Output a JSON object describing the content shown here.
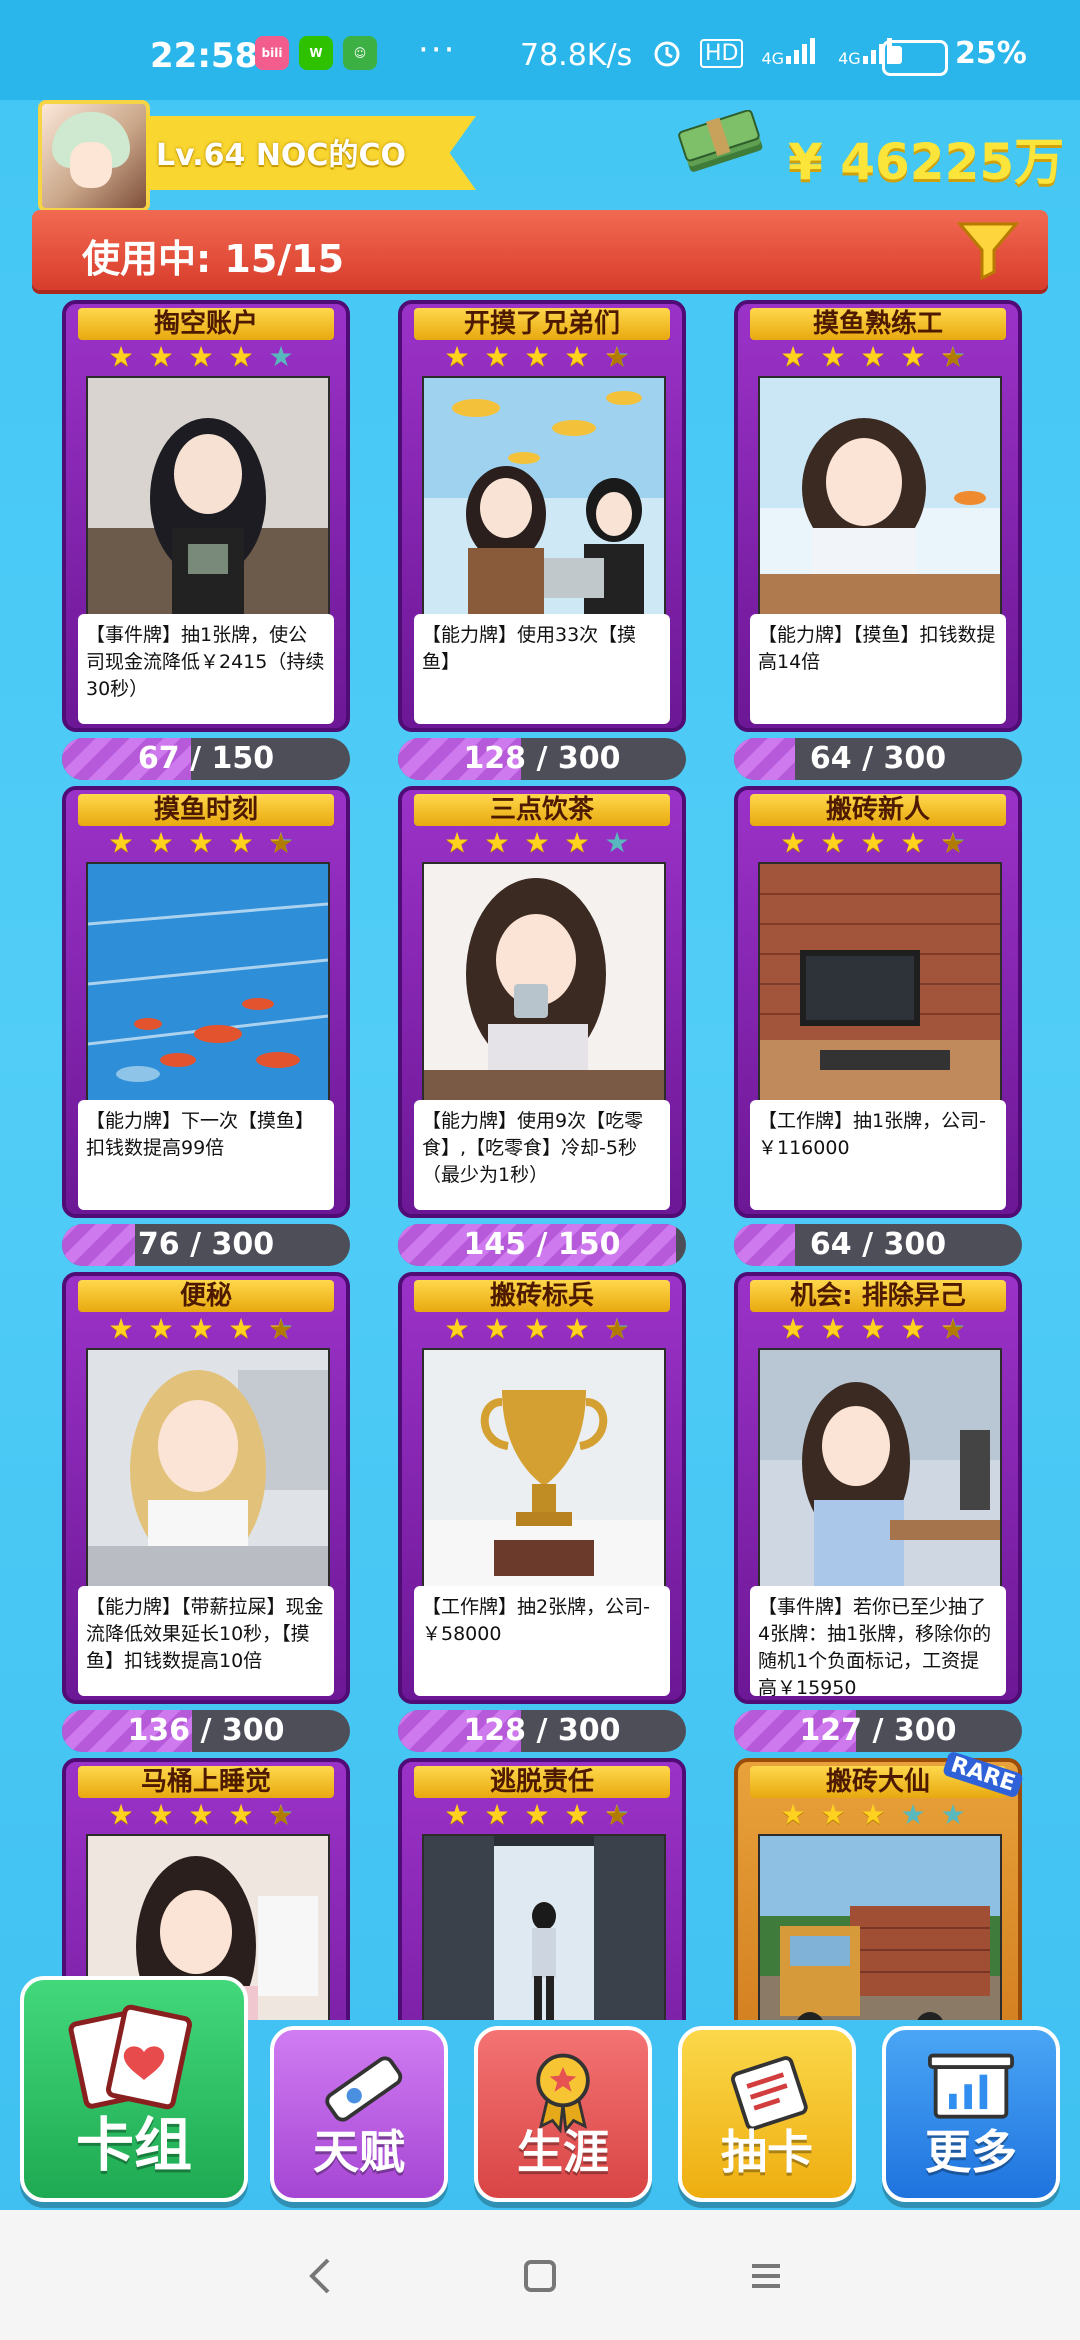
{
  "status": {
    "time": "22:58",
    "apps": [
      {
        "name": "bilibili-icon",
        "text": "bili",
        "color": "#f25d8e"
      },
      {
        "name": "wechat-icon",
        "text": "W",
        "color": "#2dc100"
      },
      {
        "name": "cat-app-icon",
        "text": "☺",
        "color": "#3cb043"
      }
    ],
    "dots": "···",
    "net_speed": "78.8K/s",
    "hd": "HD",
    "net1": "4G",
    "net2": "4G",
    "battery": "25%",
    "battery_level": 0.25
  },
  "player": {
    "level_name": "Lv.64 NOC的CO",
    "money": "¥ 46225万"
  },
  "usage": {
    "text": "使用中: 15/15"
  },
  "cards": [
    {
      "title": "掏空账户",
      "stars": [
        1,
        1,
        1,
        1,
        0
      ],
      "desc": "【事件牌】抽1张牌，使公司现金流降低￥2415（持续30秒）",
      "progress_text": "67",
      "progress_total": "/ 150",
      "progress": 0.447,
      "art": "a"
    },
    {
      "title": "开摸了兄弟们",
      "stars": [
        1,
        1,
        1,
        1,
        0.5
      ],
      "desc": "【能力牌】使用33次【摸鱼】",
      "progress_text": "128",
      "progress_total": "/ 300",
      "progress": 0.427,
      "art": "b"
    },
    {
      "title": "摸鱼熟练工",
      "stars": [
        1,
        1,
        1,
        1,
        0.5
      ],
      "desc": "【能力牌】【摸鱼】扣钱数提高14倍",
      "progress_text": "64",
      "progress_total": "/ 300",
      "progress": 0.213,
      "art": "c"
    },
    {
      "title": "摸鱼时刻",
      "stars": [
        1,
        1,
        1,
        1,
        0.5
      ],
      "desc": "【能力牌】下一次【摸鱼】扣钱数提高99倍",
      "progress_text": "76",
      "progress_total": "/ 300",
      "progress": 0.253,
      "art": "d"
    },
    {
      "title": "三点饮茶",
      "stars": [
        1,
        1,
        1,
        1,
        0
      ],
      "desc": "【能力牌】使用9次【吃零食】,【吃零食】冷却-5秒（最少为1秒）",
      "progress_text": "145",
      "progress_total": "/ 150",
      "progress": 0.967,
      "art": "e"
    },
    {
      "title": "搬砖新人",
      "stars": [
        1,
        1,
        1,
        1,
        0.5
      ],
      "desc": "【工作牌】抽1张牌，公司-￥116000",
      "progress_text": "64",
      "progress_total": "/ 300",
      "progress": 0.213,
      "art": "f"
    },
    {
      "title": "便秘",
      "stars": [
        1,
        1,
        1,
        1,
        0.5
      ],
      "desc": "【能力牌】【带薪拉屎】现金流降低效果延长10秒，【摸鱼】扣钱数提高10倍",
      "progress_text": "136",
      "progress_total": "/ 300",
      "progress": 0.453,
      "art": "g"
    },
    {
      "title": "搬砖标兵",
      "stars": [
        1,
        1,
        1,
        1,
        0.5
      ],
      "desc": "【工作牌】抽2张牌，公司-￥58000",
      "progress_text": "128",
      "progress_total": "/ 300",
      "progress": 0.427,
      "art": "h"
    },
    {
      "title": "机会: 排除异己",
      "stars": [
        1,
        1,
        1,
        1,
        0.5
      ],
      "desc": "【事件牌】若你已至少抽了4张牌：抽1张牌，移除你的随机1个负面标记，工资提高￥15950",
      "progress_text": "127",
      "progress_total": "/ 300",
      "progress": 0.423,
      "art": "i"
    },
    {
      "title": "马桶上睡觉",
      "stars": [
        1,
        1,
        1,
        1,
        0.5
      ],
      "desc": "",
      "progress_text": "",
      "progress_total": "",
      "progress": 0,
      "art": "j"
    },
    {
      "title": "逃脱责任",
      "stars": [
        1,
        1,
        1,
        1,
        0.5
      ],
      "desc": "",
      "progress_text": "",
      "progress_total": "",
      "progress": 0,
      "art": "k"
    },
    {
      "title": "搬砖大仙",
      "stars": [
        1,
        1,
        1,
        0,
        0
      ],
      "desc": "",
      "progress_text": "",
      "progress_total": "",
      "progress": 0,
      "art": "l",
      "rare": "RARE",
      "gold": true
    }
  ],
  "nav": [
    {
      "label": "卡组",
      "color": "#27c363",
      "icon": "card-deck-icon"
    },
    {
      "label": "天赋",
      "color": "#c164e6",
      "icon": "talent-scroll-icon"
    },
    {
      "label": "生涯",
      "color": "#ef5d5d",
      "icon": "career-medal-icon"
    },
    {
      "label": "抽卡",
      "color": "#f7c21a",
      "icon": "ticket-icon"
    },
    {
      "label": "更多",
      "color": "#2f8ef0",
      "icon": "more-board-icon"
    }
  ]
}
